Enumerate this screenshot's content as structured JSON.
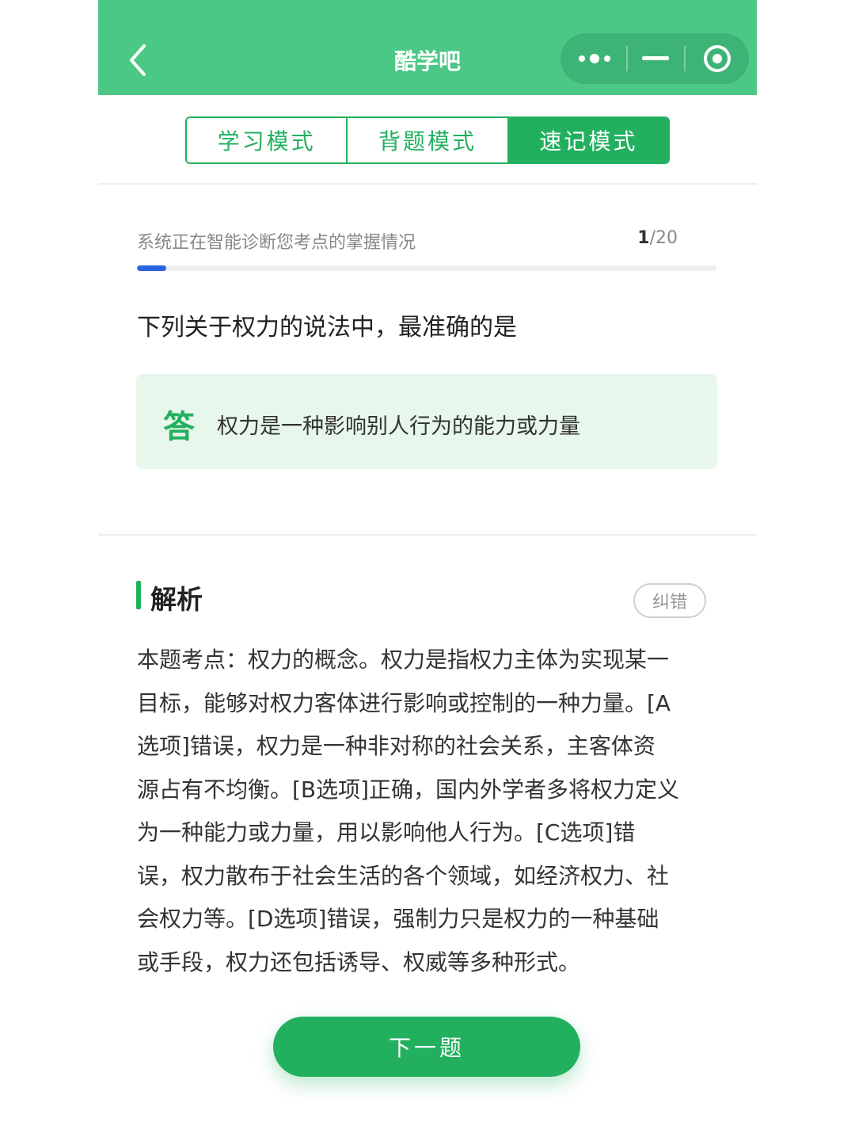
{
  "colors": {
    "header": "#4cc886",
    "accent": "#22b05f",
    "progress": "#2a64e0",
    "answer_bg": "#e7f7ec"
  },
  "header": {
    "title": "酷学吧",
    "icons": [
      "back-arrow-icon",
      "more-dots-icon",
      "minimize-icon",
      "close-target-icon"
    ]
  },
  "tabs": [
    {
      "label": "学习模式",
      "active": false
    },
    {
      "label": "背题模式",
      "active": false
    },
    {
      "label": "速记模式",
      "active": true
    }
  ],
  "progress": {
    "status_text": "系统正在智能诊断您考点的掌握情况",
    "current": "1",
    "total": "/20",
    "fraction": 0.05
  },
  "question": "下列关于权力的说法中，最准确的是",
  "answer": {
    "mark": "答",
    "text": "权力是一种影响别人行为的能力或力量"
  },
  "analysis": {
    "title": "解析",
    "report_label": "纠错",
    "lines": [
      "本题考点：权力的概念。权力是指权力主体为实现某一",
      "目标，能够对权力客体进行影响或控制的一种力量。[A",
      "选项]错误，权力是一种非对称的社会关系，主客体资",
      "源占有不均衡。[B选项]正确，国内外学者多将权力定义",
      "为一种能力或力量，用以影响他人行为。[C选项]错",
      "误，权力散布于社会生活的各个领域，如经济权力、社",
      "会权力等。[D选项]错误，强制力只是权力的一种基础",
      "或手段，权力还包括诱导、权威等多种形式。"
    ]
  },
  "next_label": "下一题"
}
